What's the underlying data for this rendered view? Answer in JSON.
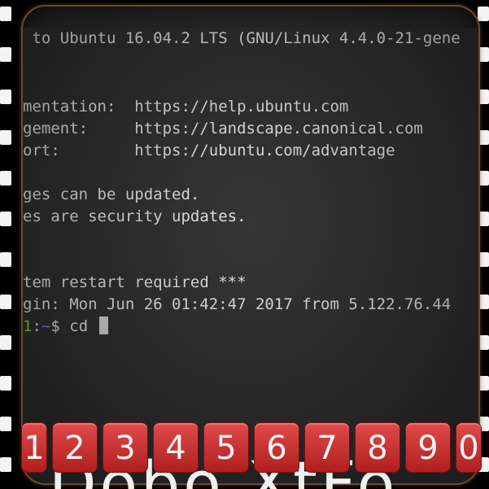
{
  "terminal": {
    "lines": [
      " to Ubuntu 16.04.2 LTS (GNU/Linux 4.4.0-21-gene",
      "",
      "",
      "mentation:  https://help.ubuntu.com",
      "gement:     https://landscape.canonical.com",
      "ort:        https://ubuntu.com/advantage",
      "",
      "ges can be updated.",
      "es are security updates.",
      "",
      "",
      "tem restart required ***",
      "gin: Mon Jun 26 01:42:47 2017 from 5.122.76.44"
    ],
    "prompt": {
      "host_fragment": "1",
      "separator": ":",
      "path": "~",
      "symbol": "$",
      "command": "cd"
    }
  },
  "number_keys": [
    "1",
    "2",
    "3",
    "4",
    "5",
    "6",
    "7",
    "8",
    "9",
    "0"
  ],
  "watermark": "Dobo XtFo"
}
